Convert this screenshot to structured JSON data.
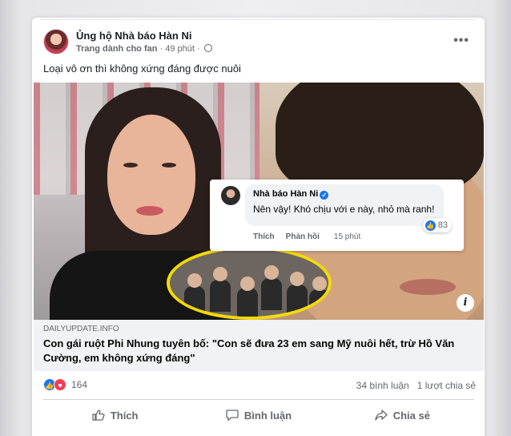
{
  "post": {
    "page_name": "Ủng hộ Nhà báo Hàn Ni",
    "subtitle_label": "Trang dành cho fan",
    "time": "· 49 phút ·",
    "caption": "Loại vô ơn thì không xứng đáng được nuôi"
  },
  "embedded_comment": {
    "author": "Nhà báo Hàn Ni",
    "text": "Nên vậy! Khó chịu với e này, nhỏ mà ranh!",
    "reaction_count": "83",
    "like_label": "Thích",
    "reply_label": "Phản hồi",
    "time": "15 phút"
  },
  "link_preview": {
    "domain": "DAILYUPDATE.INFO",
    "headline": "Con gái ruột Phi Nhung tuyên bố: \"Con sẽ đưa 23 em sang Mỹ nuôi hết, trừ Hồ Văn Cường, em không xứng đáng\""
  },
  "stats": {
    "reaction_count": "164",
    "comments": "34 bình luận",
    "shares": "1 lượt chia sẻ"
  },
  "actions": {
    "like": "Thích",
    "comment": "Bình luận",
    "share": "Chia sẻ"
  },
  "icons": [
    "globe-icon",
    "more-icon",
    "verified-icon",
    "like-icon",
    "love-icon",
    "comment-icon",
    "share-icon",
    "info-icon"
  ],
  "colors": {
    "facebook_blue": "#1877f2",
    "love_red": "#f33e58",
    "gray_text": "#65676b",
    "frame_yellow": "#f5d90a"
  }
}
